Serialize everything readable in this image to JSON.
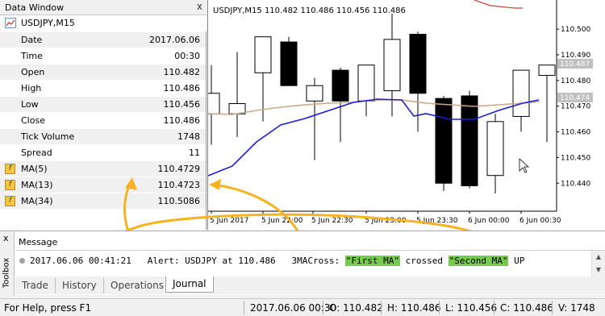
{
  "data_window": {
    "title": "Data Window",
    "close": "x",
    "symbol": "USDJPY,M15",
    "rows": [
      {
        "label": "Date",
        "value": "2017.06.06"
      },
      {
        "label": "Time",
        "value": "00:30"
      },
      {
        "label": "Open",
        "value": "110.482"
      },
      {
        "label": "High",
        "value": "110.486"
      },
      {
        "label": "Low",
        "value": "110.456"
      },
      {
        "label": "Close",
        "value": "110.486"
      },
      {
        "label": "Tick Volume",
        "value": "1748"
      },
      {
        "label": "Spread",
        "value": "11"
      },
      {
        "label": "MA(5)",
        "value": "110.4729"
      },
      {
        "label": "MA(13)",
        "value": "110.4723"
      },
      {
        "label": "MA(34)",
        "value": "110.5086"
      }
    ]
  },
  "chart": {
    "header": "USDJPY,M15  110.482 110.486 110.456 110.486",
    "price_labels": [
      "110.500",
      "110.490",
      "110.480",
      "110.470",
      "110.460",
      "110.450",
      "110.440"
    ],
    "price_tags": [
      "110.487",
      "110.474"
    ],
    "time_labels": [
      "5 Jun 2017",
      "5 Jun 22:00",
      "5 Jun 22:30",
      "5 Jun 23:00",
      "5 Jun 23:30",
      "6 Jun 00:00",
      "6 Jun 00:30"
    ],
    "candles": [
      {
        "o": 110.467,
        "h": 110.486,
        "l": 110.455,
        "c": 110.475
      },
      {
        "o": 110.467,
        "h": 110.491,
        "l": 110.458,
        "c": 110.471
      },
      {
        "o": 110.483,
        "h": 110.491,
        "l": 110.464,
        "c": 110.497
      },
      {
        "o": 110.495,
        "h": 110.497,
        "l": 110.479,
        "c": 110.478
      },
      {
        "o": 110.472,
        "h": 110.481,
        "l": 110.449,
        "c": 110.478
      },
      {
        "o": 110.484,
        "h": 110.485,
        "l": 110.456,
        "c": 110.472
      },
      {
        "o": 110.472,
        "h": 110.484,
        "l": 110.466,
        "c": 110.486
      },
      {
        "o": 110.476,
        "h": 110.506,
        "l": 110.466,
        "c": 110.496
      },
      {
        "o": 110.498,
        "h": 110.499,
        "l": 110.46,
        "c": 110.475
      },
      {
        "o": 110.473,
        "h": 110.474,
        "l": 110.437,
        "c": 110.44
      },
      {
        "o": 110.474,
        "h": 110.476,
        "l": 110.438,
        "c": 110.439
      },
      {
        "o": 110.443,
        "h": 110.467,
        "l": 110.436,
        "c": 110.464
      },
      {
        "o": 110.466,
        "h": 110.483,
        "l": 110.46,
        "c": 110.484
      },
      {
        "o": 110.482,
        "h": 110.486,
        "l": 110.456,
        "c": 110.486
      }
    ]
  },
  "toolbox": {
    "close": "x",
    "side_label": "Toolbox",
    "column_header": "Message",
    "message": {
      "time": "2017.06.06 00:41:21",
      "text1": "   Alert: USDJPY at 110.486   3MACross: ",
      "hl1": "\"First MA\"",
      "text2": " crossed ",
      "hl2": "\"Second MA\"",
      "text3": " UP"
    },
    "tabs": [
      "Trade",
      "History",
      "Operations",
      "Journal"
    ],
    "active_tab": "Journal"
  },
  "status_bar": {
    "help": "For Help, press F1",
    "datetime": "2017.06.06 00:30",
    "open": "O: 110.482",
    "high": "H: 110.486",
    "low": "L: 110.456",
    "close": "C: 110.486",
    "volume": "V: 1748"
  },
  "colors": {
    "ma_fast": "#1c1cd4",
    "ma_slow": "#c8a888",
    "arrow": "#f5b324",
    "highlight": "#79c94e"
  }
}
